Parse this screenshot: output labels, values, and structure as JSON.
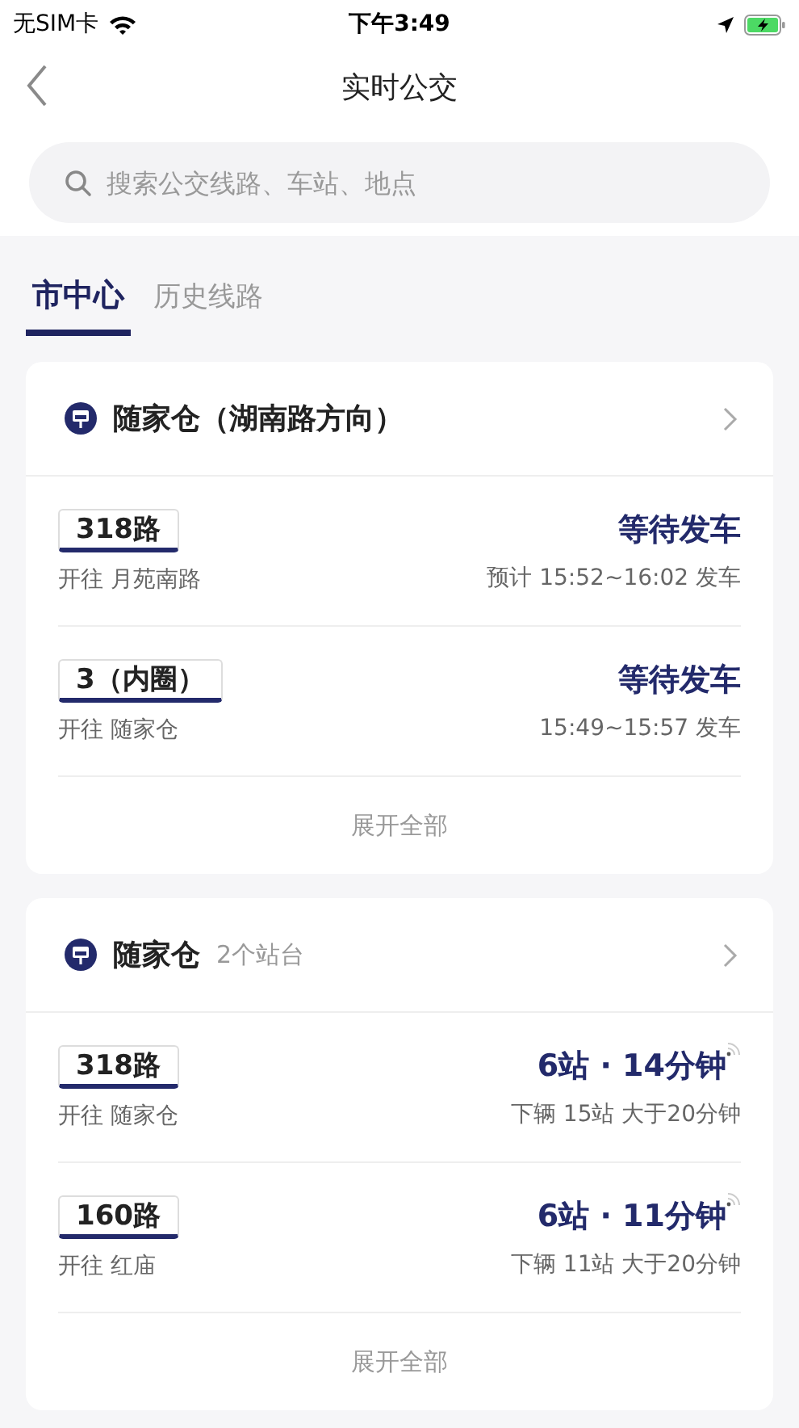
{
  "status_bar": {
    "carrier": "无SIM卡",
    "time": "下午3:49"
  },
  "nav": {
    "title": "实时公交"
  },
  "search": {
    "placeholder": "搜索公交线路、车站、地点"
  },
  "tabs": [
    {
      "label": "市中心",
      "selected": true
    },
    {
      "label": "历史线路",
      "selected": false
    }
  ],
  "cards": [
    {
      "station": "随家仓（湖南路方向）",
      "routes": [
        {
          "line": "318路",
          "destination": "开往 月苑南路",
          "status": "等待发车",
          "detail": "预计 15:52~16:02 发车",
          "realtime": false
        },
        {
          "line": "3（内圈）",
          "destination": "开往 随家仓",
          "status": "等待发车",
          "detail": "15:49~15:57 发车",
          "realtime": false
        }
      ],
      "expand": "展开全部"
    },
    {
      "station": "随家仓",
      "subtitle": "2个站台",
      "routes": [
        {
          "line": "318路",
          "destination": "开往 随家仓",
          "status": "6站 · 14分钟",
          "detail": "下辆 15站 大于20分钟",
          "realtime": true
        },
        {
          "line": "160路",
          "destination": "开往 红庙",
          "status": "6站 · 11分钟",
          "detail": "下辆 11站 大于20分钟",
          "realtime": true
        }
      ],
      "expand": "展开全部"
    }
  ]
}
